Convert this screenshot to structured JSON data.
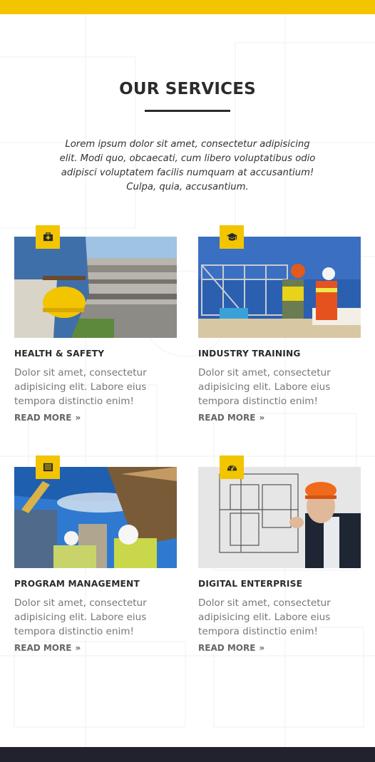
{
  "section": {
    "title": "OUR SERVICES",
    "intro": "Lorem ipsum dolor sit amet, consectetur adipisicing elit. Modi quo, obcaecati, cum libero voluptatibus odio adipisci voluptatem facilis numquam at accusantium! Culpa, quia, accusantium."
  },
  "colors": {
    "accent": "#f2c500",
    "heading": "#2b2b2b",
    "body_text": "#777777",
    "footer": "#22222e"
  },
  "services": [
    {
      "title": "HEALTH & SAFETY",
      "text": "Dolor sit amet, consectetur adipisicing elit. Labore eius tempora distinctio enim!",
      "link": "READ MORE",
      "link_arrow": "»",
      "icon": "first-aid-kit-icon"
    },
    {
      "title": "INDUSTRY TRAINING",
      "text": "Dolor sit amet, consectetur adipisicing elit. Labore eius tempora distinctio enim!",
      "link": "READ MORE",
      "link_arrow": "»",
      "icon": "graduation-cap-icon"
    },
    {
      "title": "PROGRAM MANAGEMENT",
      "text": "Dolor sit amet, consectetur adipisicing elit. Labore eius tempora distinctio enim!",
      "link": "READ MORE",
      "link_arrow": "»",
      "icon": "list-icon"
    },
    {
      "title": "DIGITAL ENTERPRISE",
      "text": "Dolor sit amet, consectetur adipisicing elit. Labore eius tempora distinctio enim!",
      "link": "READ MORE",
      "link_arrow": "»",
      "icon": "dashboard-icon"
    }
  ]
}
